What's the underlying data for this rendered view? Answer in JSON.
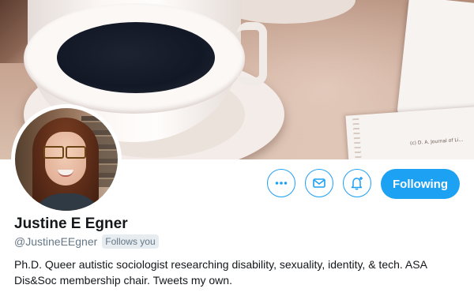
{
  "profile": {
    "name": "Justine E Egner",
    "handle": "@JustineEEgner",
    "follows_you": "Follows you",
    "bio": "Ph.D. Queer autistic sociologist researching disability, sexuality, identity, & tech. ASA Dis&Soc membership chair. Tweets my own."
  },
  "banner": {
    "copyright": "(c) D. A. Journal of Li..."
  },
  "actions": {
    "more_icon": "more-dots-icon",
    "message_icon": "envelope-icon",
    "notify_icon": "bell-plus-icon",
    "following_label": "Following"
  },
  "colors": {
    "accent": "#1da1f2",
    "text": "#14171a",
    "secondary": "#657786",
    "badge_bg": "#e6ecf0"
  }
}
